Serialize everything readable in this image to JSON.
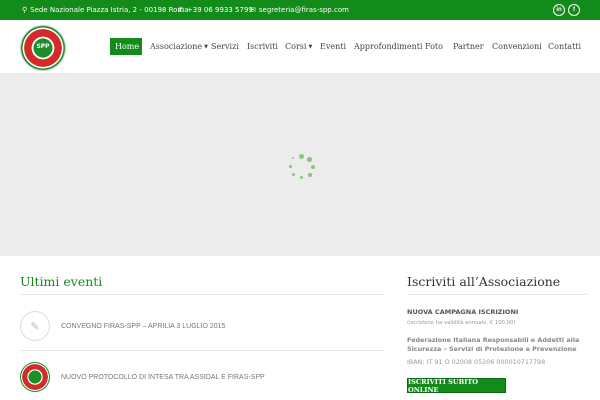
{
  "topbar": {
    "address": "Sede Nazionale Piazza Istria, 2 - 00198 Roma",
    "phone": "+39 06 9933 5799",
    "email": "segreteria@firas-spp.com",
    "address_icon": "map-marker-icon",
    "phone_icon": "phone-icon",
    "email_icon": "envelope-icon",
    "social": [
      "in",
      "f"
    ]
  },
  "logo": {
    "text": "SPP"
  },
  "nav": {
    "items": [
      {
        "label": "Home",
        "active": true
      },
      {
        "label": "Associazione",
        "dropdown": true
      },
      {
        "label": "Servizi"
      },
      {
        "label": "Iscriviti"
      },
      {
        "label": "Corsi",
        "dropdown": true
      },
      {
        "label": "Eventi"
      },
      {
        "label": "Approfondimenti"
      },
      {
        "label": "Foto"
      },
      {
        "label": "Partner"
      },
      {
        "label": "Convenzioni"
      },
      {
        "label": "Contatti"
      }
    ]
  },
  "events": {
    "title": "Ultimi eventi",
    "items": [
      {
        "title": "CONVEGNO FIRAS-SPP – APRILIA 3 LUGLIO 2015",
        "icon": "pencil-icon"
      },
      {
        "title": "NUOVO PROTOCOLLO DI INTESA TRA ASSIDAL E FIRAS-SPP",
        "icon": "logo"
      }
    ]
  },
  "subscribe": {
    "title": "Iscriviti all’Associazione",
    "campaign": "NUOVA CAMPAGNA ISCRIZIONI",
    "validity": "(iscrizione ha validità annuale, € 100,00)",
    "federation": "Federazione Italiana Responsabili e Addetti alla Sicurezza – Servizi di Protezione e Prevenzione",
    "iban": "IBAN: IT 91 O 02008 05206 000010717798",
    "cta": "ISCRIVITI SUBITO ONLINE"
  },
  "colors": {
    "brand_green": "#138b1a",
    "slider_bg": "#ececec",
    "spinner": "#86c77c"
  }
}
